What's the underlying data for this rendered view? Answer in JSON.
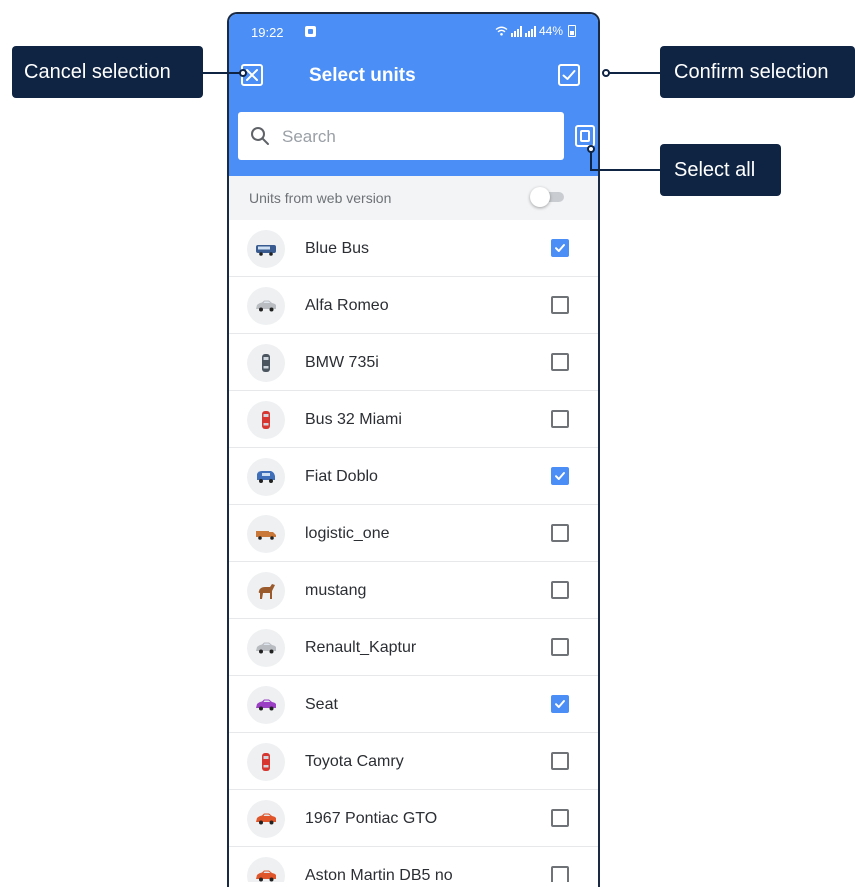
{
  "status_bar": {
    "time": "19:22",
    "battery": "44%"
  },
  "header": {
    "title": "Select units",
    "search_placeholder": "Search"
  },
  "web_version": {
    "label": "Units from web version",
    "enabled": false
  },
  "units": [
    {
      "name": "Blue Bus",
      "checked": true,
      "icon": "bus-icon",
      "color": "#3a5b8f"
    },
    {
      "name": "Alfa Romeo",
      "checked": false,
      "icon": "car-icon",
      "color": "#b9bcc0"
    },
    {
      "name": "BMW 735i",
      "checked": false,
      "icon": "car-top-icon",
      "color": "#4a5560"
    },
    {
      "name": "Bus 32 Miami",
      "checked": false,
      "icon": "car-top-icon",
      "color": "#d6362f"
    },
    {
      "name": "Fiat Doblo",
      "checked": true,
      "icon": "van-icon",
      "color": "#3f6fb8"
    },
    {
      "name": "logistic_one",
      "checked": false,
      "icon": "truck-icon",
      "color": "#c9783a"
    },
    {
      "name": "mustang",
      "checked": false,
      "icon": "horse-icon",
      "color": "#9a5a2c"
    },
    {
      "name": "Renault_Kaptur",
      "checked": false,
      "icon": "car-icon",
      "color": "#b9bcc0"
    },
    {
      "name": "Seat",
      "checked": true,
      "icon": "car-icon",
      "color": "#9b3fc4"
    },
    {
      "name": "Toyota Camry",
      "checked": false,
      "icon": "car-top-icon",
      "color": "#d6362f"
    },
    {
      "name": "1967 Pontiac GTO",
      "checked": false,
      "icon": "car-icon",
      "color": "#e0562a"
    },
    {
      "name": "Aston Martin DB5 no",
      "checked": false,
      "icon": "car-icon",
      "color": "#e0562a"
    }
  ],
  "callouts": {
    "cancel": "Cancel selection",
    "confirm": "Confirm selection",
    "select_all": "Select all"
  },
  "colors": {
    "accent": "#4b8ef5",
    "callout": "#0f2443"
  }
}
